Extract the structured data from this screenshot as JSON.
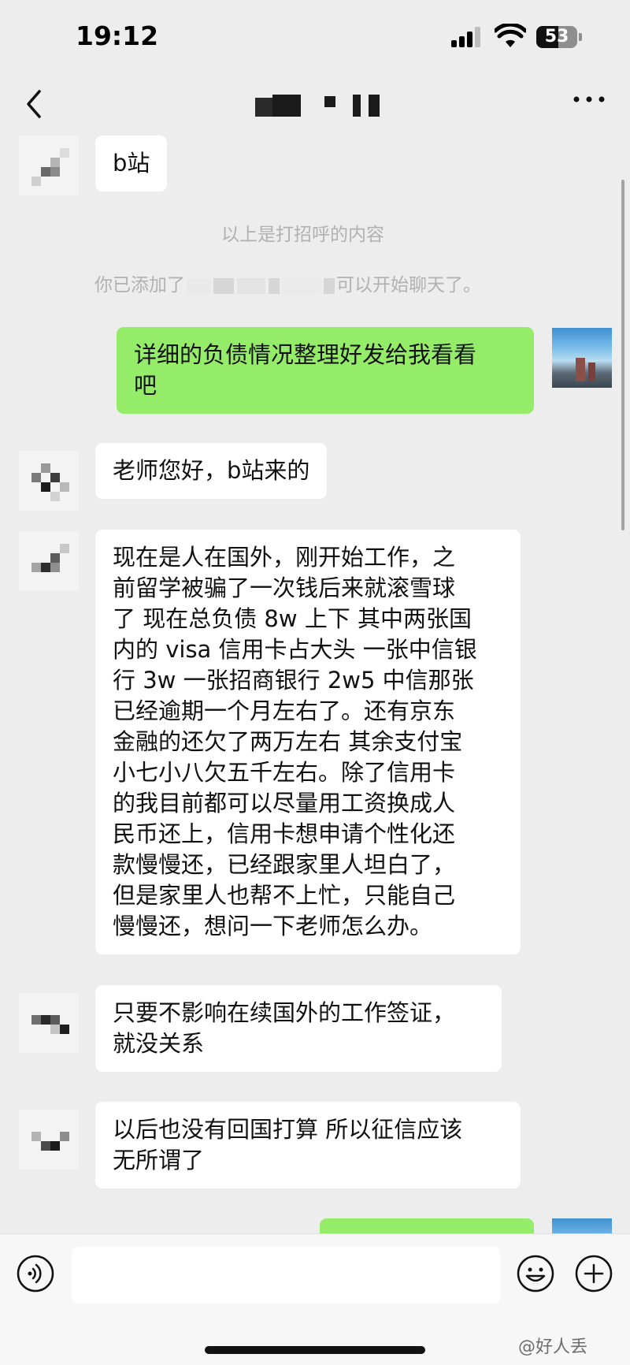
{
  "status_bar": {
    "time": "19:12",
    "battery_level": "53",
    "icons": [
      "signal-icon",
      "wifi-icon",
      "battery-icon"
    ]
  },
  "nav": {
    "back_icon": "chevron-left-icon",
    "more_icon": "more-icon"
  },
  "messages": [
    {
      "sender": "contact",
      "text": "b站"
    },
    {
      "type": "system",
      "text": "以上是打招呼的内容"
    },
    {
      "type": "system",
      "prefix": "你已添加了",
      "suffix": "可以开始聊天了。"
    },
    {
      "sender": "self",
      "text": "详细的负债情况整理好发给我看看\n吧"
    },
    {
      "sender": "contact",
      "text": "老师您好，b站来的"
    },
    {
      "sender": "contact",
      "text": "现在是人在国外，刚开始工作，之\n前留学被骗了一次钱后来就滚雪球\n了 现在总负债 8w 上下 其中两张国\n内的 visa 信用卡占大头 一张中信银\n行 3w 一张招商银行 2w5 中信那张\n已经逾期一个月左右了。还有京东\n金融的还欠了两万左右 其余支付宝\n小七小八欠五千左右。除了信用卡\n的我目前都可以尽量用工资换成人\n民币还上，信用卡想申请个性化还\n款慢慢还，已经跟家里人坦白了，\n但是家里人也帮不上忙，只能自己\n慢慢还，想问一下老师怎么办。"
    },
    {
      "sender": "contact",
      "text": "只要不影响在续国外的工作签证，\n就没关系"
    },
    {
      "sender": "contact",
      "text": "以后也没有回国打算 所以征信应该\n无所谓了"
    },
    {
      "sender": "self",
      "text": ""
    }
  ],
  "input_bar": {
    "input_value": "",
    "icons": [
      "voice-icon",
      "emoji-icon",
      "plus-icon"
    ]
  },
  "watermark": "@好人丢"
}
